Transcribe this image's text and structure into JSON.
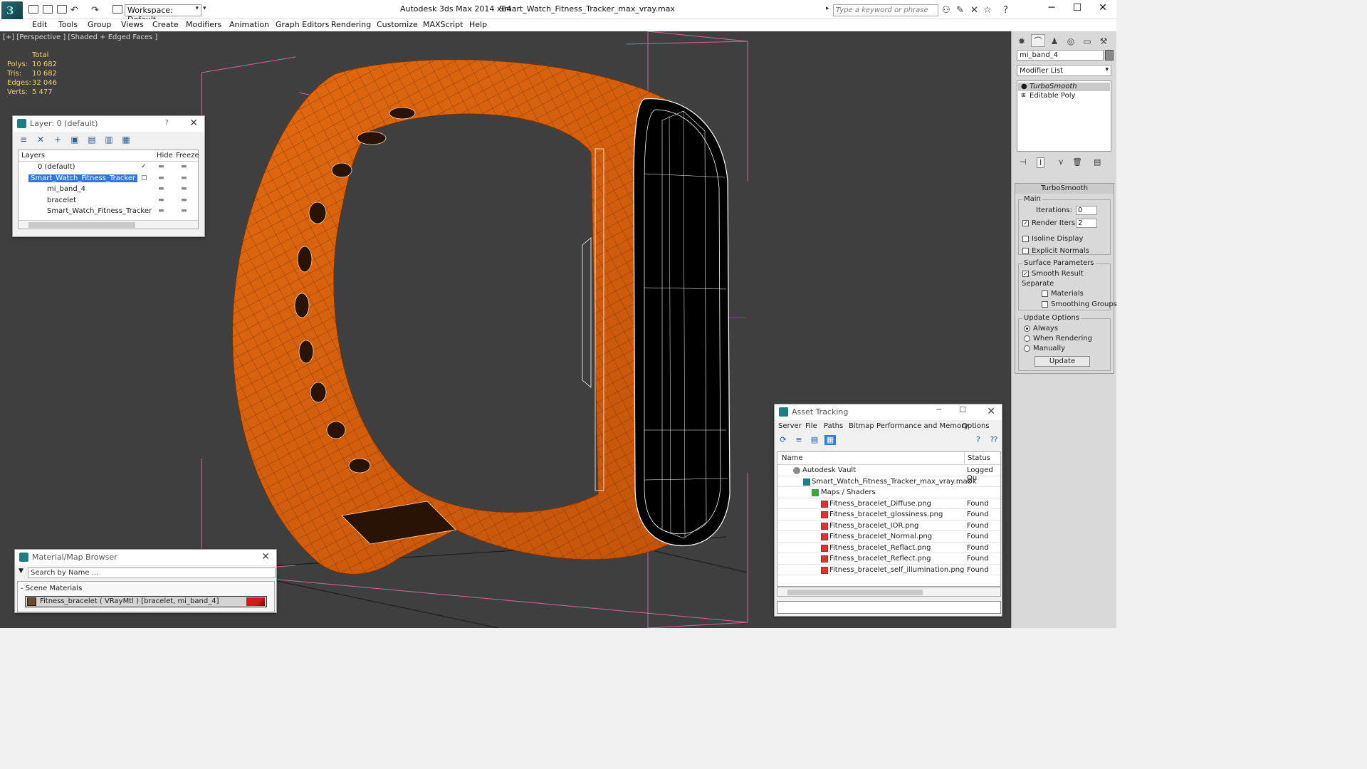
{
  "titlebar": {
    "app_title": "Autodesk 3ds Max  2014 x64",
    "file_name": "Smart_Watch_Fitness_Tracker_max_vray.max",
    "workspace_label": "Workspace: Default",
    "search_placeholder": "Type a keyword or phrase"
  },
  "menu": [
    "Edit",
    "Tools",
    "Group",
    "Views",
    "Create",
    "Modifiers",
    "Animation",
    "Graph Editors",
    "Rendering",
    "Customize",
    "MAXScript",
    "Help"
  ],
  "viewport": {
    "label": "[+] [Perspective ] [Shaded + Edged Faces ]",
    "stats_header": "Total",
    "stats": [
      {
        "k": "Polys:",
        "v": "10 682"
      },
      {
        "k": "Tris:",
        "v": "10 682"
      },
      {
        "k": "Edges:",
        "v": "32 046"
      },
      {
        "k": "Verts:",
        "v": "5 477"
      }
    ],
    "colors": {
      "band": "#d35d0a",
      "band_dark": "#a84405",
      "wire": "#ffffff",
      "bg": "#3f3f3f"
    }
  },
  "layer_dialog": {
    "title": "Layer: 0 (default)",
    "help": "?",
    "col_layers": "Layers",
    "col_hide": "Hide",
    "col_freeze": "Freeze",
    "rows": [
      {
        "name": "0 (default)"
      },
      {
        "name": "Smart_Watch_Fitness_Tracker"
      },
      {
        "name": "mi_band_4"
      },
      {
        "name": "bracelet"
      },
      {
        "name": "Smart_Watch_Fitness_Tracker"
      }
    ]
  },
  "material_browser": {
    "title": "Material/Map Browser",
    "search_placeholder": "Search by Name ...",
    "section": "- Scene Materials",
    "item": "Fitness_bracelet  ( VRayMtl )  [bracelet, mi_band_4]"
  },
  "asset_tracking": {
    "title": "Asset Tracking",
    "menu": [
      "Server",
      "File",
      "Paths",
      "Bitmap Performance and Memory",
      "Options"
    ],
    "col_name": "Name",
    "col_status": "Status",
    "rows": [
      {
        "name": "Autodesk Vault",
        "status": "Logged Ou"
      },
      {
        "name": "Smart_Watch_Fitness_Tracker_max_vray.max",
        "status": "Ok"
      },
      {
        "name": "Maps / Shaders",
        "status": ""
      },
      {
        "name": "Fitness_bracelet_Diffuse.png",
        "status": "Found"
      },
      {
        "name": "Fitness_bracelet_glossiness.png",
        "status": "Found"
      },
      {
        "name": "Fitness_bracelet_IOR.png",
        "status": "Found"
      },
      {
        "name": "Fitness_bracelet_Normal.png",
        "status": "Found"
      },
      {
        "name": "Fitness_bracelet_Reflact.png",
        "status": "Found"
      },
      {
        "name": "Fitness_bracelet_Reflect.png",
        "status": "Found"
      },
      {
        "name": "Fitness_bracelet_self_illumination.png",
        "status": "Found"
      }
    ]
  },
  "command_panel": {
    "object_name": "mi_band_4",
    "modifier_list": "Modifier List",
    "stack": [
      "TurboSmooth",
      "Editable Poly"
    ],
    "rollout_title": "TurboSmooth",
    "main_group": "Main",
    "iterations_label": "Iterations:",
    "iterations": "0",
    "render_iters_label": "Render Iters:",
    "render_iters": "2",
    "isoline": "Isoline Display",
    "explicit_normals": "Explicit Normals",
    "surface_group": "Surface Parameters",
    "smooth_result": "Smooth Result",
    "separate": "Separate",
    "materials": "Materials",
    "smoothing_groups": "Smoothing Groups",
    "update_group": "Update Options",
    "always": "Always",
    "when_rendering": "When Rendering",
    "manually": "Manually",
    "update_button": "Update"
  }
}
